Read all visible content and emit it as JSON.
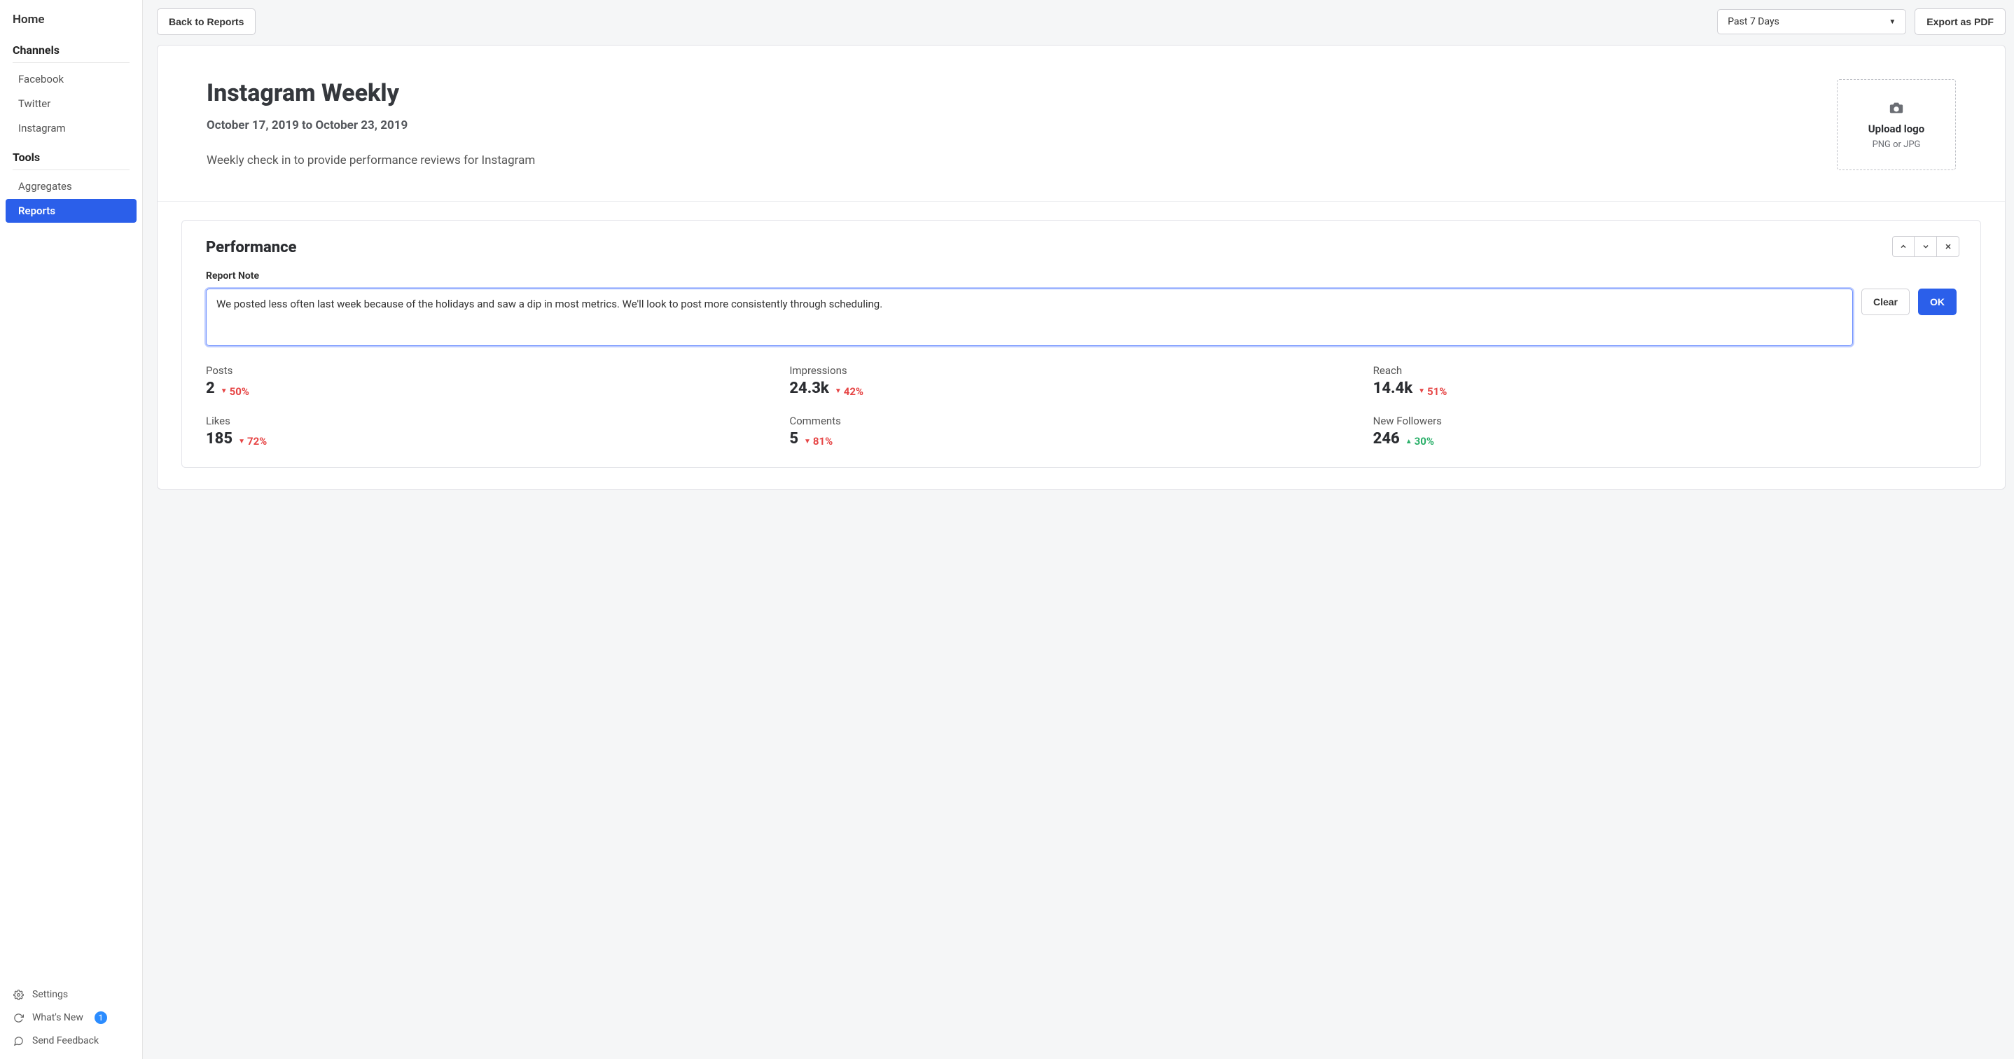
{
  "sidebar": {
    "home": "Home",
    "channelsTitle": "Channels",
    "channels": [
      "Facebook",
      "Twitter",
      "Instagram"
    ],
    "toolsTitle": "Tools",
    "tools": [
      {
        "label": "Aggregates",
        "active": false
      },
      {
        "label": "Reports",
        "active": true
      }
    ],
    "footer": {
      "settings": "Settings",
      "whatsnew": "What's New",
      "whatsnewBadge": "1",
      "feedback": "Send Feedback"
    }
  },
  "topbar": {
    "back": "Back to Reports",
    "dateRangeSelect": "Past 7 Days",
    "export": "Export as PDF"
  },
  "report": {
    "title": "Instagram Weekly",
    "dateRange": "October 17, 2019 to October 23, 2019",
    "description": "Weekly check in to provide performance reviews for Instagram",
    "upload": {
      "title": "Upload logo",
      "sub": "PNG or JPG"
    }
  },
  "performance": {
    "title": "Performance",
    "noteLabel": "Report Note",
    "noteValue": "We posted less often last week because of the holidays and saw a dip in most metrics. We'll look to post more consistently through scheduling.",
    "clear": "Clear",
    "ok": "OK",
    "metrics": [
      {
        "label": "Posts",
        "value": "2",
        "change": "50%",
        "direction": "down"
      },
      {
        "label": "Impressions",
        "value": "24.3k",
        "change": "42%",
        "direction": "down"
      },
      {
        "label": "Reach",
        "value": "14.4k",
        "change": "51%",
        "direction": "down"
      },
      {
        "label": "Likes",
        "value": "185",
        "change": "72%",
        "direction": "down"
      },
      {
        "label": "Comments",
        "value": "5",
        "change": "81%",
        "direction": "down"
      },
      {
        "label": "New Followers",
        "value": "246",
        "change": "30%",
        "direction": "up"
      }
    ]
  }
}
